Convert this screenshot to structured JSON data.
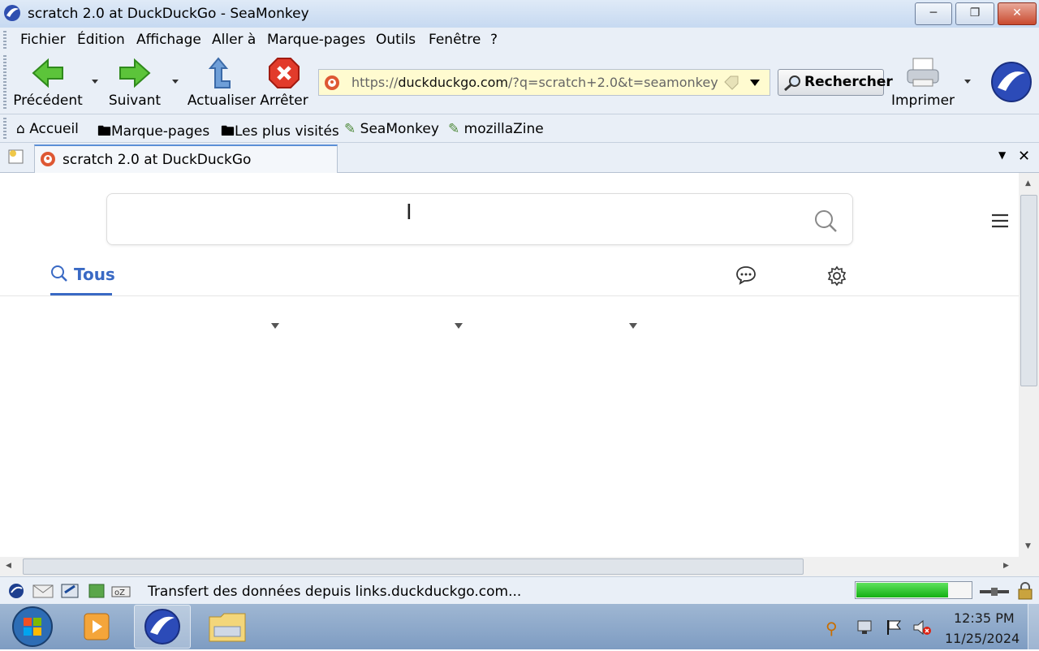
{
  "window": {
    "title": "scratch 2.0 at DuckDuckGo - SeaMonkey"
  },
  "menu": [
    "Fichier",
    "Édition",
    "Affichage",
    "Aller à",
    "Marque-pages",
    "Outils",
    "Fenêtre",
    "?"
  ],
  "navbar": {
    "back": "Précédent",
    "forward": "Suivant",
    "reload": "Actualiser",
    "stop": "Arrêter",
    "url_prefix": "https://",
    "url_host": "duckduckgo.com",
    "url_rest": "/?q=scratch+2.0&t=seamonkey&",
    "search_button": "Rechercher",
    "print": "Imprimer"
  },
  "bookmarks": [
    "Accueil",
    "Marque-pages",
    "Les plus visités",
    "SeaMonkey",
    "mozillaZine"
  ],
  "tab": {
    "title": "scratch 2.0 at DuckDuckGo"
  },
  "page": {
    "search_value": "",
    "tab_all": "Tous"
  },
  "status": {
    "text": "Transfert des données depuis links.duckduckgo.com...",
    "progress": 0.8
  },
  "taskbar": {
    "time": "12:35 PM",
    "date": "11/25/2024"
  },
  "colors": {
    "accent": "#3969c4",
    "progress": "#14b014",
    "urlbar_bg": "#fffbd0"
  }
}
